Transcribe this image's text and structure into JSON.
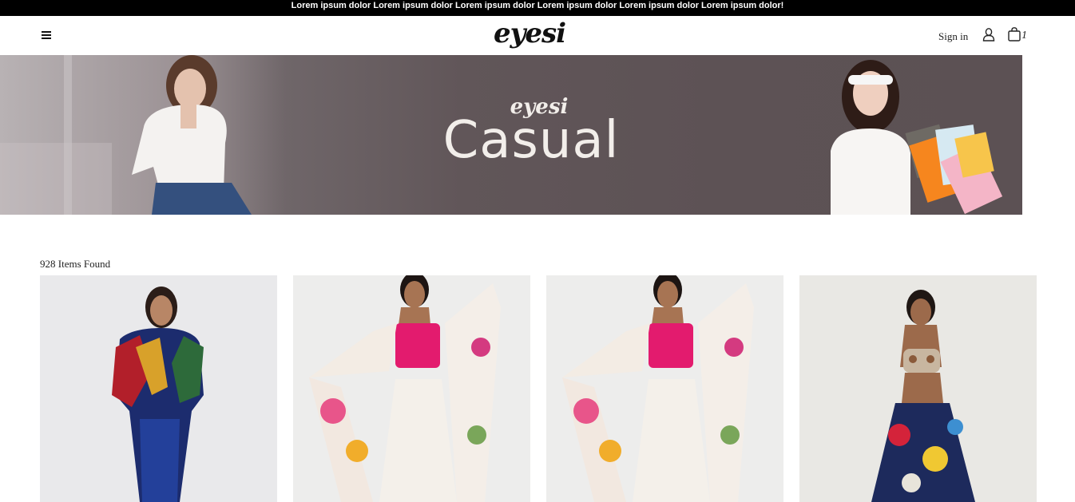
{
  "announcement": "Lorem ipsum dolor Lorem ipsum dolor Lorem ipsum dolor Lorem ipsum dolor Lorem ipsum dolor Lorem ipsum dolor!",
  "header": {
    "logo": "eyesi",
    "menu_icon": "hamburger-menu-icon",
    "signin_label": "Sign in",
    "user_icon": "user-icon",
    "cart_icon": "shopping-bag-icon",
    "cart_count": "1"
  },
  "banner": {
    "logo": "eyesi",
    "title": "Casual",
    "background_color": "#5d5255"
  },
  "listing": {
    "items_found": "928 Items Found",
    "products": [
      {
        "description": "printed draped kaftan dress"
      },
      {
        "description": "pink bustier with white draped skirt and floral cape"
      },
      {
        "description": "pink bustier with white draped skirt and floral cape"
      },
      {
        "description": "embellished bralette with printed lehenga skirt"
      }
    ]
  },
  "colors": {
    "announcement_bg": "#000000",
    "text": "#222222"
  }
}
